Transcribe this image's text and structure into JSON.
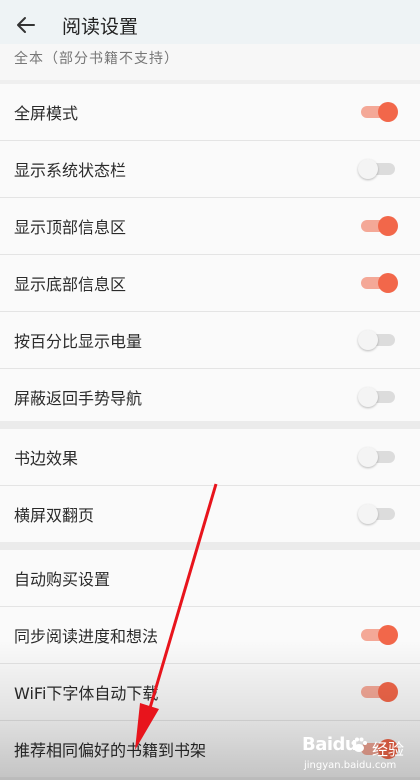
{
  "header": {
    "title": "阅读设置",
    "back_icon": "arrow-left-icon"
  },
  "partial_row": {
    "label": "全本（部分书籍不支持）"
  },
  "colors": {
    "accent": "#f2674a",
    "accent_track": "#f4a897",
    "off_track": "#dcdcdc",
    "arrow": "#e8141c"
  },
  "sections": [
    {
      "rows": [
        {
          "label": "全屏模式",
          "on": true
        },
        {
          "label": "显示系统状态栏",
          "on": false
        },
        {
          "label": "显示顶部信息区",
          "on": true
        },
        {
          "label": "显示底部信息区",
          "on": true
        },
        {
          "label": "按百分比显示电量",
          "on": false
        },
        {
          "label": "屏蔽返回手势导航",
          "on": false
        }
      ]
    },
    {
      "rows": [
        {
          "label": "书边效果",
          "on": false
        },
        {
          "label": "横屏双翻页",
          "on": false
        }
      ]
    },
    {
      "rows": [
        {
          "label": "自动购买设置",
          "on": null
        },
        {
          "label": "同步阅读进度和想法",
          "on": true
        },
        {
          "label": "WiFi下字体自动下载",
          "on": true
        },
        {
          "label": "推荐相同偏好的书籍到书架",
          "on": true
        }
      ]
    }
  ],
  "watermark": {
    "brand": "Bai",
    "brand_suffix": "du",
    "cn": "经验",
    "url": "jingyan.baidu.com"
  }
}
